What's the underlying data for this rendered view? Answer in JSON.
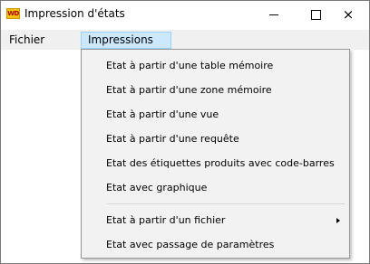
{
  "window": {
    "title": "Impression d'états",
    "icon_text": "WD",
    "icon_color": "#f4c20d",
    "controls": {
      "minimize": "minimize-icon",
      "maximize": "maximize-icon",
      "close": "×"
    }
  },
  "menubar": {
    "items": [
      {
        "label": "Fichier"
      },
      {
        "label": "Impressions",
        "active": true
      }
    ],
    "active_color": "#cce8ff"
  },
  "dropdown": {
    "items": [
      {
        "label": "Etat à partir d'une table mémoire"
      },
      {
        "label": "Etat à partir d'une zone mémoire"
      },
      {
        "label": "Etat à partir d'une vue"
      },
      {
        "label": "Etat à partir d'une requête"
      },
      {
        "label": "Etat des étiquettes produits avec code-barres"
      },
      {
        "label": "Etat avec graphique"
      },
      {
        "label": "Etat à partir d'un fichier",
        "has_submenu": true
      },
      {
        "label": "Etat avec passage de paramètres"
      }
    ]
  }
}
